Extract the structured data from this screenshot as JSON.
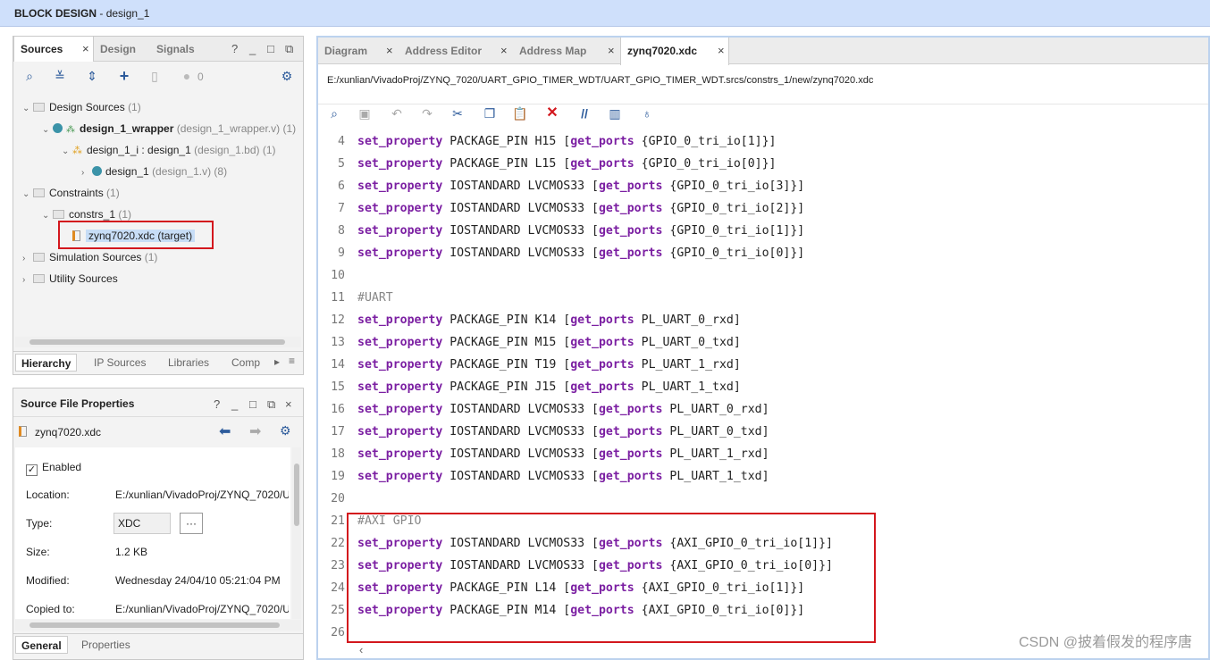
{
  "titlebar": {
    "prefix": "BLOCK DESIGN",
    "suffix": "- design_1"
  },
  "sources_panel": {
    "tabs": [
      "Sources",
      "Design",
      "Signals"
    ],
    "ctl": [
      "?",
      "_",
      "□",
      "⧉"
    ],
    "toolbar": {
      "zero": "0"
    },
    "tree": {
      "design_sources": "Design Sources",
      "design_sources_count": "(1)",
      "wrapper_name": "design_1_wrapper",
      "wrapper_meta": "(design_1_wrapper.v) (1)",
      "design_i": "design_1_i : design_1",
      "design_i_meta": "(design_1.bd) (1)",
      "design_1": "design_1",
      "design_1_meta": "(design_1.v) (8)",
      "constraints": "Constraints",
      "constraints_count": "(1)",
      "constrs": "constrs_1",
      "constrs_count": "(1)",
      "xdc_file": "zynq7020.xdc (target)",
      "sim_sources": "Simulation Sources",
      "sim_count": "(1)",
      "util_sources": "Utility Sources"
    },
    "bottom_tabs": [
      "Hierarchy",
      "IP Sources",
      "Libraries",
      "Comp"
    ]
  },
  "props_panel": {
    "title": "Source File Properties",
    "filename": "zynq7020.xdc",
    "enabled": "Enabled",
    "location_label": "Location:",
    "location_value": "E:/xunlian/VivadoProj/ZYNQ_7020/U",
    "type_label": "Type:",
    "type_value": "XDC",
    "type_btn": "···",
    "size_label": "Size:",
    "size_value": "1.2 KB",
    "modified_label": "Modified:",
    "modified_value": "Wednesday 24/04/10 05:21:04 PM",
    "copied_label": "Copied to:",
    "copied_value": "E:/xunlian/VivadoProj/ZYNQ_7020/U",
    "bottom_tabs": [
      "General",
      "Properties"
    ]
  },
  "editor": {
    "tabs": [
      "Diagram",
      "Address Editor",
      "Address Map",
      "zynq7020.xdc"
    ],
    "path": "E:/xunlian/VivadoProj/ZYNQ_7020/UART_GPIO_TIMER_WDT/UART_GPIO_TIMER_WDT.srcs/constrs_1/new/zynq7020.xdc",
    "lines": [
      {
        "n": "4",
        "kw": "set_property",
        "mid": " PACKAGE_PIN H15 ",
        "kw2": "get_ports",
        "tail": " {GPIO_0_tri_io[1]}]"
      },
      {
        "n": "5",
        "kw": "set_property",
        "mid": " PACKAGE_PIN L15 ",
        "kw2": "get_ports",
        "tail": " {GPIO_0_tri_io[0]}]"
      },
      {
        "n": "6",
        "kw": "set_property",
        "mid": " IOSTANDARD LVCMOS33 ",
        "kw2": "get_ports",
        "tail": " {GPIO_0_tri_io[3]}]"
      },
      {
        "n": "7",
        "kw": "set_property",
        "mid": " IOSTANDARD LVCMOS33 ",
        "kw2": "get_ports",
        "tail": " {GPIO_0_tri_io[2]}]"
      },
      {
        "n": "8",
        "kw": "set_property",
        "mid": " IOSTANDARD LVCMOS33 ",
        "kw2": "get_ports",
        "tail": " {GPIO_0_tri_io[1]}]"
      },
      {
        "n": "9",
        "kw": "set_property",
        "mid": " IOSTANDARD LVCMOS33 ",
        "kw2": "get_ports",
        "tail": " {GPIO_0_tri_io[0]}]"
      },
      {
        "n": "10",
        "comment": ""
      },
      {
        "n": "11",
        "comment": "#UART"
      },
      {
        "n": "12",
        "kw": "set_property",
        "mid": " PACKAGE_PIN K14 ",
        "kw2": "get_ports",
        "tail": " PL_UART_0_rxd]"
      },
      {
        "n": "13",
        "kw": "set_property",
        "mid": " PACKAGE_PIN M15 ",
        "kw2": "get_ports",
        "tail": " PL_UART_0_txd]"
      },
      {
        "n": "14",
        "kw": "set_property",
        "mid": " PACKAGE_PIN T19 ",
        "kw2": "get_ports",
        "tail": " PL_UART_1_rxd]"
      },
      {
        "n": "15",
        "kw": "set_property",
        "mid": " PACKAGE_PIN J15 ",
        "kw2": "get_ports",
        "tail": " PL_UART_1_txd]"
      },
      {
        "n": "16",
        "kw": "set_property",
        "mid": " IOSTANDARD LVCMOS33 ",
        "kw2": "get_ports",
        "tail": " PL_UART_0_rxd]"
      },
      {
        "n": "17",
        "kw": "set_property",
        "mid": " IOSTANDARD LVCMOS33 ",
        "kw2": "get_ports",
        "tail": " PL_UART_0_txd]"
      },
      {
        "n": "18",
        "kw": "set_property",
        "mid": " IOSTANDARD LVCMOS33 ",
        "kw2": "get_ports",
        "tail": " PL_UART_1_rxd]"
      },
      {
        "n": "19",
        "kw": "set_property",
        "mid": " IOSTANDARD LVCMOS33 ",
        "kw2": "get_ports",
        "tail": " PL_UART_1_txd]"
      },
      {
        "n": "20",
        "comment": ""
      },
      {
        "n": "21",
        "comment": "#AXI GPIO"
      },
      {
        "n": "22",
        "kw": "set_property",
        "mid": " IOSTANDARD LVCMOS33 ",
        "kw2": "get_ports",
        "tail": " {AXI_GPIO_0_tri_io[1]}]"
      },
      {
        "n": "23",
        "kw": "set_property",
        "mid": " IOSTANDARD LVCMOS33 ",
        "kw2": "get_ports",
        "tail": " {AXI_GPIO_0_tri_io[0]}]"
      },
      {
        "n": "24",
        "kw": "set_property",
        "mid": " PACKAGE_PIN L14 ",
        "kw2": "get_ports",
        "tail": " {AXI_GPIO_0_tri_io[1]}]"
      },
      {
        "n": "25",
        "kw": "set_property",
        "mid": " PACKAGE_PIN M14 ",
        "kw2": "get_ports",
        "tail": " {AXI_GPIO_0_tri_io[0]}]"
      },
      {
        "n": "26",
        "comment": ""
      }
    ]
  },
  "watermark": "CSDN @披着假发的程序唐",
  "colors": {
    "accent": "#2d5b9b",
    "keyword": "#7b1fa2",
    "highlight_box": "#d3171d"
  }
}
